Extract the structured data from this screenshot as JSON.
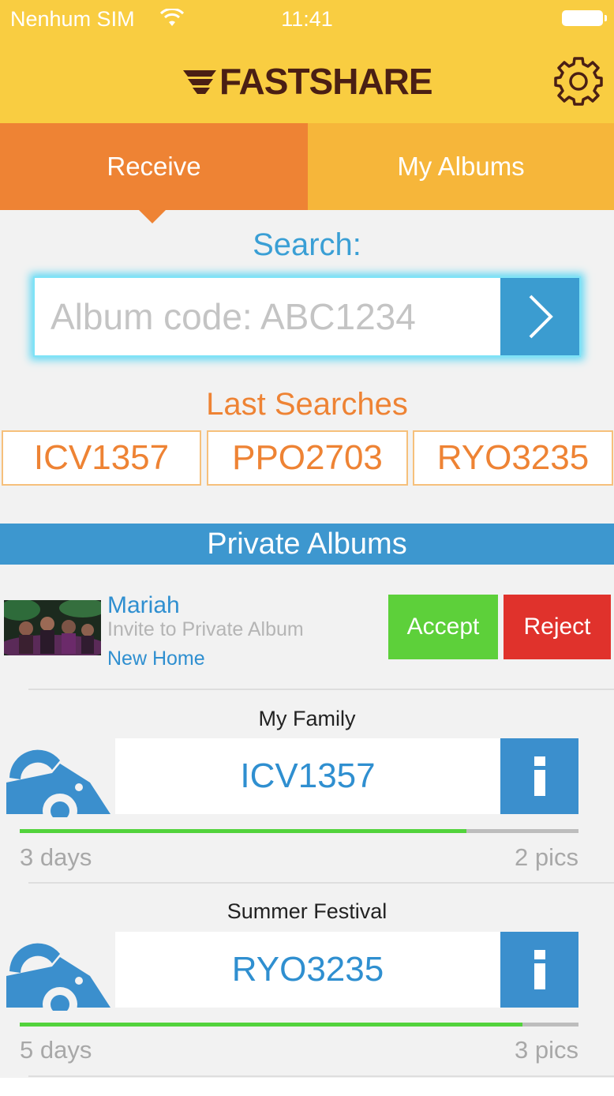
{
  "status_bar": {
    "carrier": "Nenhum SIM",
    "time": "11:41"
  },
  "header": {
    "logo_text": "FASTSHARE",
    "settings_icon": "gear-icon",
    "colors": {
      "background": "#f9cd41",
      "logo": "#4a1f14"
    }
  },
  "tabs": [
    {
      "label": "Receive",
      "active": true,
      "color": "#ee8334"
    },
    {
      "label": "My Albums",
      "active": false,
      "color": "#f6b63a"
    }
  ],
  "search": {
    "heading": "Search:",
    "placeholder": "Album code: ABC1234",
    "value": "",
    "go_icon": "chevron-right-icon"
  },
  "last_searches": {
    "heading": "Last Searches",
    "items": [
      "ICV1357",
      "PPO2703",
      "RYO3235"
    ]
  },
  "private_albums": {
    "heading": "Private Albums",
    "invite": {
      "name": "Mariah",
      "subtitle": "Invite to Private Album",
      "album": "New Home",
      "accept_label": "Accept",
      "reject_label": "Reject"
    },
    "albums": [
      {
        "title": "My Family",
        "code": "ICV1357",
        "days": "3 days",
        "pics": "2 pics",
        "progress": 0.8
      },
      {
        "title": "Summer Festival",
        "code": "RYO3235",
        "days": "5 days",
        "pics": "3 pics",
        "progress": 0.9
      }
    ]
  }
}
